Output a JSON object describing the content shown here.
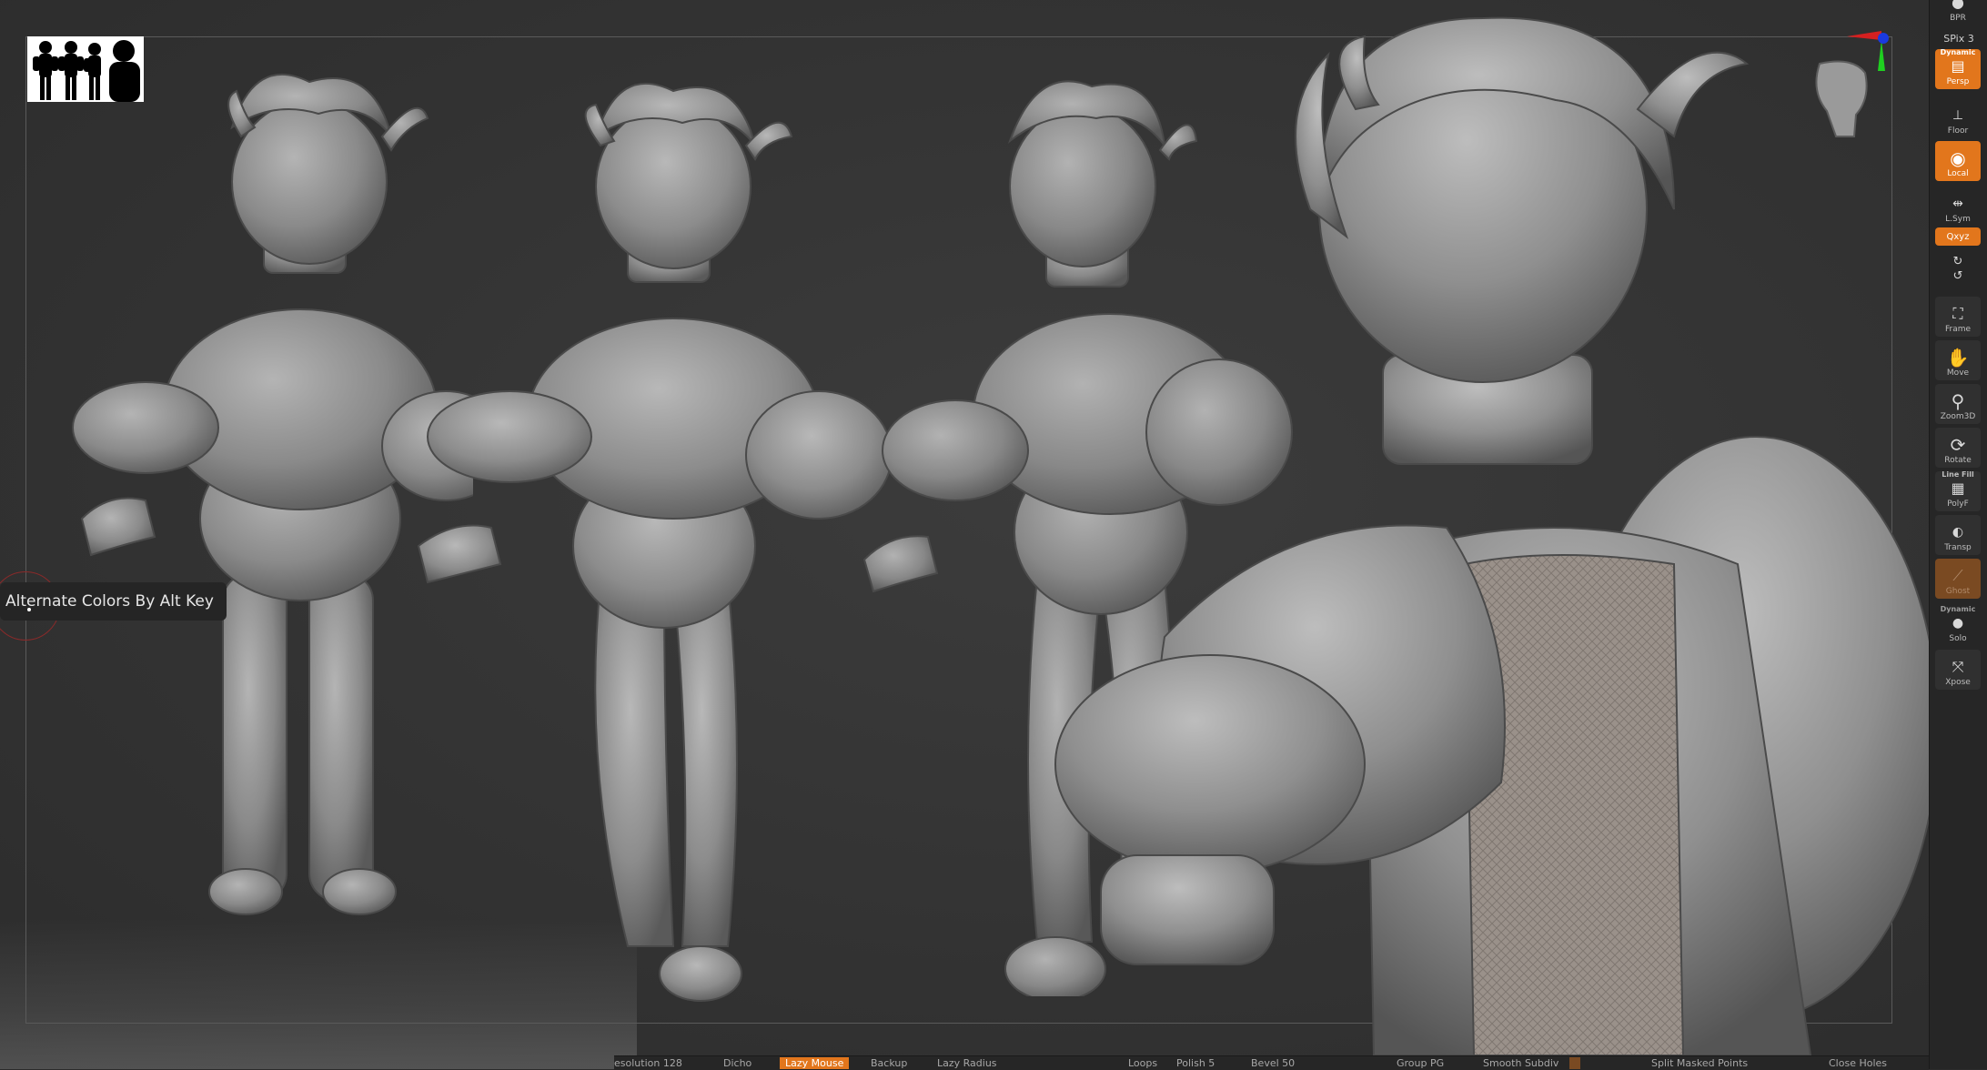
{
  "viewport": {
    "tooltip_text": "Alternate Colors By Alt Key"
  },
  "shelf": {
    "bpr": "BPR",
    "spix": "SPix 3",
    "dynamic_top": "Dynamic",
    "persp": "Persp",
    "floor": "Floor",
    "local": "Local",
    "lsym": "L.Sym",
    "xyz": "Qxyz",
    "frame": "Frame",
    "move": "Move",
    "zoom3d": "Zoom3D",
    "rotate": "Rotate",
    "linefill": "Line Fill",
    "polyf": "PolyF",
    "transp": "Transp",
    "ghost": "Ghost",
    "dynamic_mid": "Dynamic",
    "solo": "Solo",
    "xpose": "Xpose"
  },
  "status": {
    "resolution": "esolution 128",
    "item2": "Dicho",
    "item3": "Lazy Mouse",
    "item4": "Backup",
    "item5": "Lazy Radius",
    "item6": "Loops",
    "item7": "Polish 5",
    "item8": "Bevel 50",
    "item9": "Group PG",
    "item10": "Smooth Subdiv",
    "item11": "Split Masked Points",
    "item12": "Close Holes"
  },
  "colors": {
    "accent_orange": "#e2761c",
    "viewport_bg": "#333333",
    "clay": "#8e8e8e"
  }
}
